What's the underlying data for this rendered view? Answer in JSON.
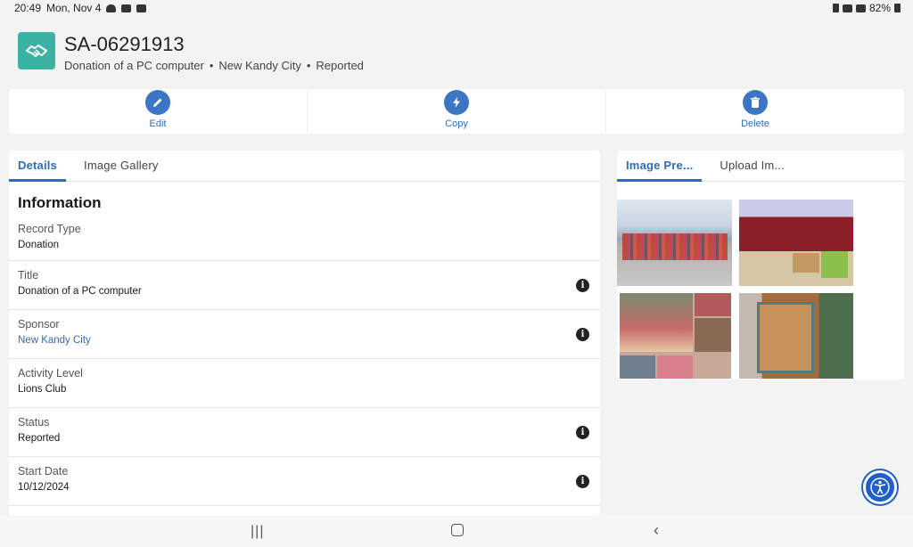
{
  "status_bar": {
    "time": "20:49",
    "date": "Mon, Nov 4",
    "battery": "82%",
    "notification_icons": [
      "cloud-icon",
      "youtube-icon",
      "photo-icon"
    ],
    "system_icons": [
      "alarm-icon",
      "wifi-icon",
      "signal-icon",
      "battery-icon"
    ]
  },
  "record": {
    "id": "SA-06291913",
    "subtitle_title": "Donation of a PC computer",
    "subtitle_sponsor": "New Kandy City",
    "subtitle_status": "Reported",
    "icon": "handshake-icon"
  },
  "actions": [
    {
      "label": "Edit",
      "icon": "pencil-icon"
    },
    {
      "label": "Copy",
      "icon": "lightning-icon"
    },
    {
      "label": "Delete",
      "icon": "trash-icon"
    }
  ],
  "details_tabs": [
    {
      "label": "Details",
      "active": true
    },
    {
      "label": "Image Gallery",
      "active": false
    }
  ],
  "section_title": "Information",
  "fields": [
    {
      "label": "Record Type",
      "value": "Donation",
      "info": false,
      "link": false
    },
    {
      "label": "Title",
      "value": "Donation of a PC computer",
      "info": true,
      "link": false
    },
    {
      "label": "Sponsor",
      "value": "New Kandy City",
      "info": true,
      "link": true
    },
    {
      "label": "Activity Level",
      "value": "Lions Club",
      "info": false,
      "link": false
    },
    {
      "label": "Status",
      "value": "Reported",
      "info": true,
      "link": false
    },
    {
      "label": "Start Date",
      "value": "10/12/2024",
      "info": true,
      "link": false
    }
  ],
  "info_glyph": "i",
  "preview_tabs": [
    {
      "label": "Image Pre...",
      "active": true
    },
    {
      "label": "Upload Im...",
      "active": false
    }
  ],
  "colors": {
    "accent": "#2d6cb8",
    "action_circle": "#3a76c4",
    "record_icon": "#3bb3a3",
    "fab": "#1f5fc7"
  },
  "nav": {
    "recents": "|||",
    "back": "‹"
  }
}
